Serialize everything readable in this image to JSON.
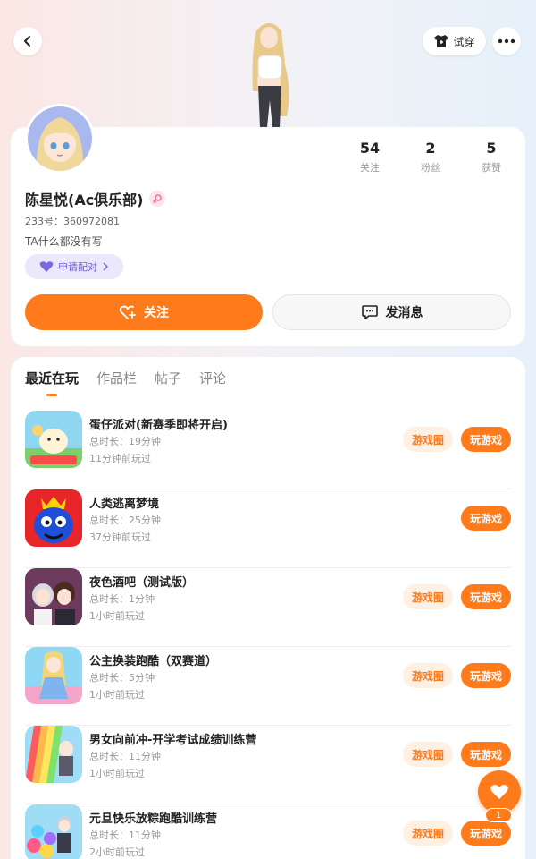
{
  "topbar": {
    "try_label": "试穿"
  },
  "profile": {
    "name": "陈星悦(Ac俱乐部)",
    "uid": "233号：360972081",
    "bio": "TA什么都没有写",
    "pair_label": "申请配对",
    "stats": [
      {
        "num": "54",
        "label": "关注"
      },
      {
        "num": "2",
        "label": "粉丝"
      },
      {
        "num": "5",
        "label": "获赞"
      }
    ],
    "follow_label": "关注",
    "message_label": "发消息"
  },
  "tabs": [
    {
      "label": "最近在玩",
      "active": true
    },
    {
      "label": "作品栏",
      "active": false
    },
    {
      "label": "帖子",
      "active": false
    },
    {
      "label": "评论",
      "active": false
    }
  ],
  "games": [
    {
      "title": "蛋仔派对(新赛季即将开启)",
      "duration": "总时长：19分钟",
      "ago": "11分钟前玩过",
      "circle_label": "游戏圈",
      "play_label": "玩游戏"
    },
    {
      "title": "人类逃离梦境",
      "duration": "总时长：25分钟",
      "ago": "37分钟前玩过",
      "circle_label": "",
      "play_label": "玩游戏"
    },
    {
      "title": "夜色酒吧（测试版）",
      "duration": "总时长：1分钟",
      "ago": "1小时前玩过",
      "circle_label": "游戏圈",
      "play_label": "玩游戏"
    },
    {
      "title": "公主换装跑酷（双赛道）",
      "duration": "总时长：5分钟",
      "ago": "1小时前玩过",
      "circle_label": "游戏圈",
      "play_label": "玩游戏"
    },
    {
      "title": "男女向前冲-开学考试成绩训练营",
      "duration": "总时长：11分钟",
      "ago": "1小时前玩过",
      "circle_label": "游戏圈",
      "play_label": "玩游戏"
    },
    {
      "title": "元旦快乐放粽跑酷训练营",
      "duration": "总时长：11分钟",
      "ago": "2小时前玩过",
      "circle_label": "游戏圈",
      "play_label": "玩游戏"
    }
  ],
  "like_count": "1"
}
